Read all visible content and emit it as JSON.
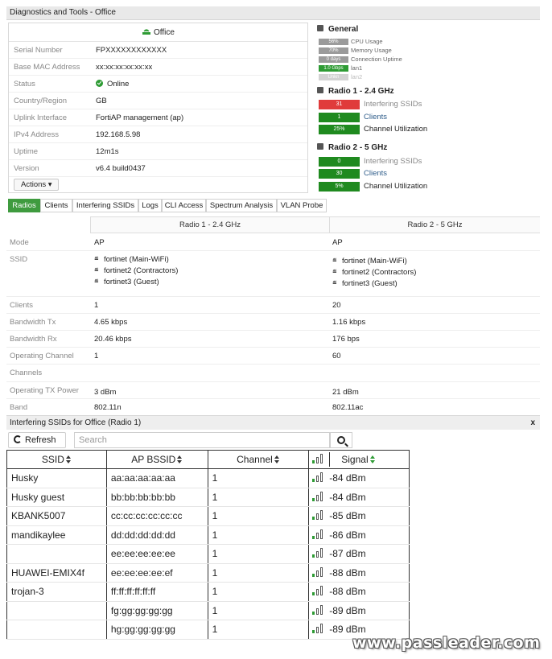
{
  "window": {
    "title": "Diagnostics and Tools - Office"
  },
  "card": {
    "device_name": "Office",
    "rows": [
      {
        "key": "Serial Number",
        "value": "FPXXXXXXXXXXXX"
      },
      {
        "key": "Base MAC Address",
        "value": "xx:xx:xx:xx:xx:xx"
      },
      {
        "key": "Status",
        "value": "Online"
      },
      {
        "key": "Country/Region",
        "value": "GB"
      },
      {
        "key": "Uplink Interface",
        "value": "FortiAP management (ap)"
      },
      {
        "key": "IPv4 Address",
        "value": "192.168.5.98"
      },
      {
        "key": "Uptime",
        "value": "12m1s"
      },
      {
        "key": "Version",
        "value": "v6.4 build0437"
      }
    ],
    "actions_label": "Actions ▾"
  },
  "general": {
    "title": "General",
    "items": [
      {
        "badge": "56%",
        "label": "CPU Usage",
        "color": "#9b9b9b"
      },
      {
        "badge": "70%",
        "label": "Memory Usage",
        "color": "#9b9b9b"
      },
      {
        "badge": "0 days",
        "label": "Connection Uptime",
        "color": "#9b9b9b"
      },
      {
        "badge": "1.0 Gbps",
        "label": "lan1",
        "color": "#2e9b34"
      },
      {
        "badge": "Unkn",
        "label": "lan2",
        "color": "#d3d3d3"
      }
    ]
  },
  "radio1": {
    "title": "Radio 1 - 2.4 GHz",
    "stats": [
      {
        "value": "31",
        "label": "Interfering SSIDs",
        "color": "#e03b3b",
        "label_color": "#888888"
      },
      {
        "value": "1",
        "label": "Clients",
        "color": "#1f8a1f",
        "label_color": "#2f5d8a"
      },
      {
        "value": "25%",
        "label": "Channel Utilization",
        "color": "#1f8a1f",
        "label_color": "#222222"
      }
    ]
  },
  "radio2": {
    "title": "Radio 2 - 5 GHz",
    "stats": [
      {
        "value": "0",
        "label": "Interfering SSIDs",
        "color": "#1f8a1f",
        "label_color": "#888888"
      },
      {
        "value": "30",
        "label": "Clients",
        "color": "#1f8a1f",
        "label_color": "#2f5d8a"
      },
      {
        "value": "5%",
        "label": "Channel Utilization",
        "color": "#1f8a1f",
        "label_color": "#222222"
      }
    ]
  },
  "tabs": [
    "Radios",
    "Clients",
    "Interfering SSIDs",
    "Logs",
    "CLI Access",
    "Spectrum Analysis",
    "VLAN Probe"
  ],
  "radios_table": {
    "col1": "Radio 1 - 2.4 GHz",
    "col2": "Radio 2 - 5 GHz",
    "rows": {
      "mode": {
        "key": "Mode",
        "r1": "AP",
        "r2": "AP"
      },
      "ssid": {
        "key": "SSID",
        "r1": [
          "fortinet (Main-WiFi)",
          "fortinet2 (Contractors)",
          "fortinet3 (Guest)"
        ],
        "r2": [
          "fortinet (Main-WiFi)",
          "fortinet2 (Contractors)",
          "fortinet3 (Guest)"
        ]
      },
      "clients": {
        "key": "Clients",
        "r1": "1",
        "r2": "20"
      },
      "bw_tx": {
        "key": "Bandwidth Tx",
        "r1": "4.65 kbps",
        "r2": "1.16 kbps"
      },
      "bw_rx": {
        "key": "Bandwidth Rx",
        "r1": "20.46 kbps",
        "r2": "176 bps"
      },
      "op_channel": {
        "key": "Operating Channel",
        "r1": "1",
        "r2": "60"
      },
      "channels": {
        "key": "Channels",
        "r1": "",
        "r2": ""
      },
      "tx_power": {
        "key": "Operating TX Power",
        "r1": "3 dBm",
        "r2": "21 dBm"
      },
      "band": {
        "key": "Band",
        "r1": "802.11n",
        "r2": "802.11ac"
      }
    }
  },
  "interfering_panel": {
    "title": "Interfering SSIDs for Office (Radio 1)",
    "close": "x",
    "refresh_label": "Refresh",
    "search_placeholder": "Search",
    "headers": {
      "ssid": "SSID",
      "bssid": "AP BSSID",
      "channel": "Channel",
      "signal": "Signal"
    },
    "rows": [
      {
        "ssid": "Husky",
        "bssid": "aa:aa:aa:aa:aa",
        "channel": "1",
        "signal": "-84 dBm",
        "bars": 1
      },
      {
        "ssid": "Husky guest",
        "bssid": "bb:bb:bb:bb:bb",
        "channel": "1",
        "signal": "-84 dBm",
        "bars": 1
      },
      {
        "ssid": "KBANK5007",
        "bssid": "cc:cc:cc:cc:cc:cc",
        "channel": "1",
        "signal": "-85 dBm",
        "bars": 1
      },
      {
        "ssid": "mandikaylee",
        "bssid": "dd:dd:dd:dd:dd",
        "channel": "1",
        "signal": "-86 dBm",
        "bars": 1
      },
      {
        "ssid": "",
        "bssid": "ee:ee:ee:ee:ee",
        "channel": "1",
        "signal": "-87 dBm",
        "bars": 1
      },
      {
        "ssid": "HUAWEI-EMIX4f",
        "bssid": "ee:ee:ee:ee:ef",
        "channel": "1",
        "signal": "-88 dBm",
        "bars": 1
      },
      {
        "ssid": "trojan-3",
        "bssid": "ff:ff:ff:ff:ff:ff",
        "channel": "1",
        "signal": "-88 dBm",
        "bars": 1
      },
      {
        "ssid": "",
        "bssid": "fg:gg:gg:gg:gg",
        "channel": "1",
        "signal": "-89 dBm",
        "bars": 1
      },
      {
        "ssid": "",
        "bssid": "hg:gg:gg:gg:gg",
        "channel": "1",
        "signal": "-89 dBm",
        "bars": 1
      }
    ]
  },
  "watermark": "www.passleader.com"
}
